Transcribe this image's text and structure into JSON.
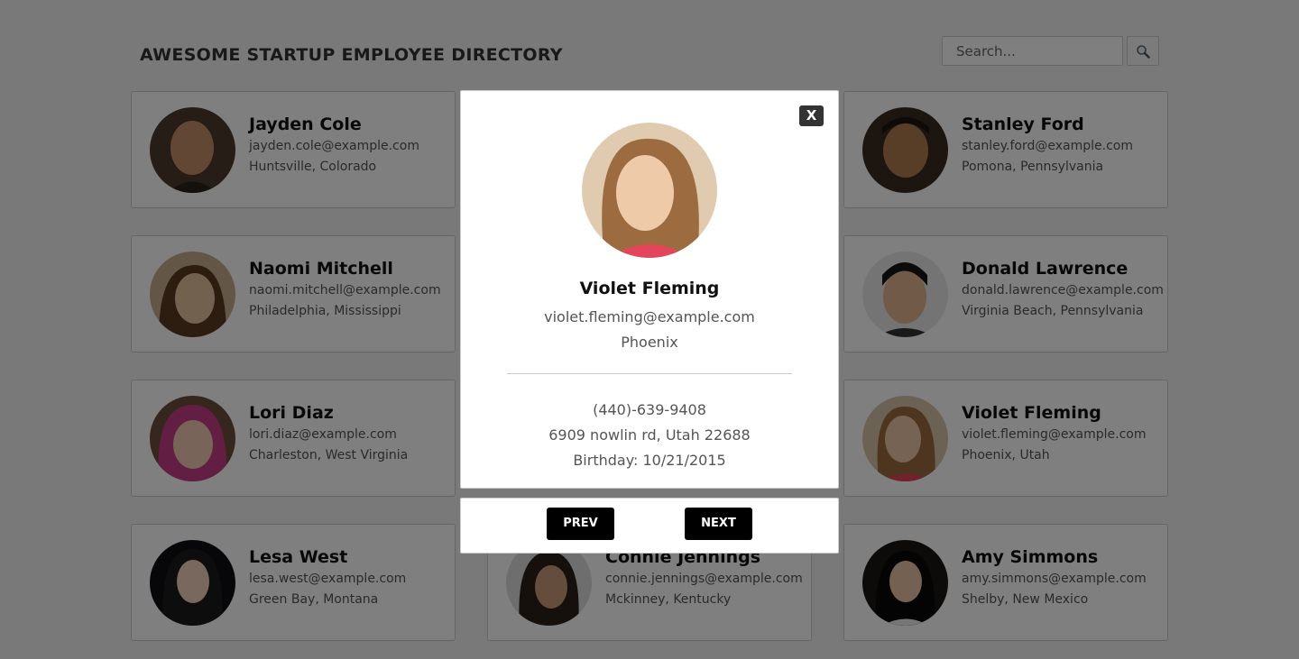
{
  "header": {
    "title": "AWESOME STARTUP EMPLOYEE DIRECTORY",
    "search_placeholder": "Search...",
    "search_icon": "magnifier-icon"
  },
  "employees": [
    {
      "name": "Jayden Cole",
      "email": "jayden.cole@example.com",
      "location": "Huntsville, Colorado"
    },
    {
      "name": "Stanley Ford",
      "email": "stanley.ford@example.com",
      "location": "Pomona, Pennsylvania"
    },
    {
      "name": "Naomi Mitchell",
      "email": "naomi.mitchell@example.com",
      "location": "Philadelphia, Mississippi"
    },
    {
      "name": "Donald Lawrence",
      "email": "donald.lawrence@example.com",
      "location": "Virginia Beach, Pennsylvania"
    },
    {
      "name": "Lori Diaz",
      "email": "lori.diaz@example.com",
      "location": "Charleston, West Virginia"
    },
    {
      "name": "Violet Fleming",
      "email": "violet.fleming@example.com",
      "location": "Phoenix, Utah"
    },
    {
      "name": "Lesa West",
      "email": "lesa.west@example.com",
      "location": "Green Bay, Montana"
    },
    {
      "name": "Connie Jennings",
      "email": "connie.jennings@example.com",
      "location": "Mckinney, Kentucky"
    },
    {
      "name": "Amy Simmons",
      "email": "amy.simmons@example.com",
      "location": "Shelby, New Mexico"
    }
  ],
  "modal": {
    "close_label": "X",
    "name": "Violet Fleming",
    "email": "violet.fleming@example.com",
    "city": "Phoenix",
    "phone": "(440)-639-9408",
    "address": "6909 nowlin rd, Utah 22688",
    "birthday": "Birthday: 10/21/2015",
    "prev_label": "PREV",
    "next_label": "NEXT"
  },
  "colors": {
    "overlay": "#000000",
    "button_bg": "#000000",
    "close_bg": "#333333"
  }
}
